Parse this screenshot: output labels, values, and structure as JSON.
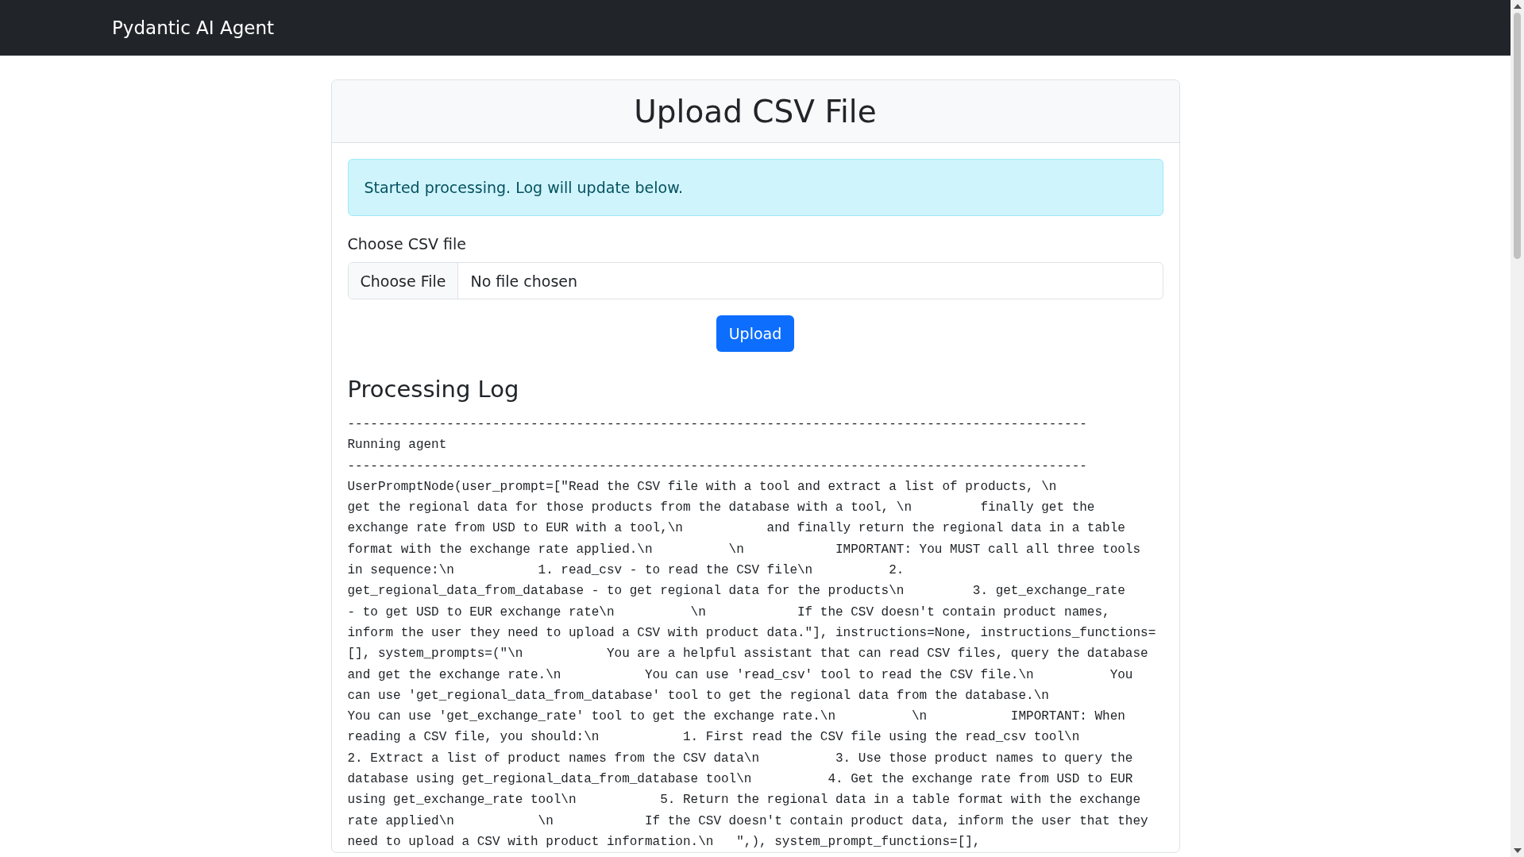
{
  "navbar": {
    "brand": "Pydantic AI Agent"
  },
  "card": {
    "title": "Upload CSV File",
    "alert": "Started processing. Log will update below.",
    "file_field": {
      "label": "Choose CSV file",
      "button": "Choose File",
      "value": "No file chosen"
    },
    "upload_button": "Upload",
    "log_title": "Processing Log",
    "log_lines": [
      "-------------------------------------------------------------------------------------------------",
      "Running agent",
      "-------------------------------------------------------------------------------------------------",
      "UserPromptNode(user_prompt=[\"Read the CSV file with a tool and extract a list of products, \\n",
      "get the regional data for those products from the database with a tool, \\n         finally get the",
      "exchange rate from USD to EUR with a tool,\\n           and finally return the regional data in a table",
      "format with the exchange rate applied.\\n          \\n            IMPORTANT: You MUST call all three tools",
      "in sequence:\\n           1. read_csv - to read the CSV file\\n          2.",
      "get_regional_data_from_database - to get regional data for the products\\n         3. get_exchange_rate",
      "- to get USD to EUR exchange rate\\n          \\n            If the CSV doesn't contain product names,",
      "inform the user they need to upload a CSV with product data.\"], instructions=None, instructions_functions=",
      "[], system_prompts=(\"\\n           You are a helpful assistant that can read CSV files, query the database",
      "and get the exchange rate.\\n           You can use 'read_csv' tool to read the CSV file.\\n          You",
      "can use 'get_regional_data_from_database' tool to get the regional data from the database.\\n",
      "You can use 'get_exchange_rate' tool to get the exchange rate.\\n          \\n           IMPORTANT: When",
      "reading a CSV file, you should:\\n           1. First read the CSV file using the read_csv tool\\n",
      "2. Extract a list of product names from the CSV data\\n          3. Use those product names to query the",
      "database using get_regional_data_from_database tool\\n          4. Get the exchange rate from USD to EUR",
      "using get_exchange_rate tool\\n           5. Return the regional data in a table format with the exchange",
      "rate applied\\n           \\n            If the CSV doesn't contain product data, inform the user that they",
      "need to upload a CSV with product information.\\n   \",), system_prompt_functions=[],"
    ]
  }
}
